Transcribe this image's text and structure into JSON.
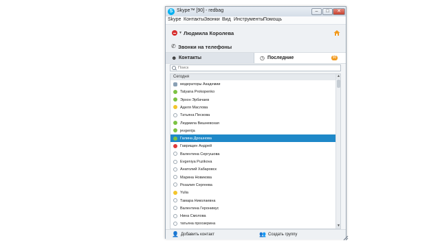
{
  "window": {
    "title": "Skype™ [90] - redbag",
    "icon_letter": "S",
    "controls": {
      "minimize": "–",
      "maximize": "□",
      "close": "✕"
    }
  },
  "menu": [
    "Skype",
    "Контакты",
    "Звонки",
    "Вид",
    "Инструменты",
    "Помощь"
  ],
  "profile": {
    "name": "Людмила Королева",
    "status": "busy",
    "home_icon": "home-icon"
  },
  "calls": {
    "label": "Звонки на телефоны"
  },
  "tabs": {
    "contacts": "Контакты",
    "recent": "Последние",
    "recent_badge": "90"
  },
  "search": {
    "placeholder": "Поиск"
  },
  "list": {
    "group": "Сегодня",
    "contacts": [
      {
        "name": "модераторы Академии",
        "status": "group"
      },
      {
        "name": "Tatyana Prokopenko",
        "status": "online"
      },
      {
        "name": "Эрхон Эрбачаев",
        "status": "online"
      },
      {
        "name": "Аделя Маслова",
        "status": "away"
      },
      {
        "name": "Татьяна Пескова",
        "status": "offline"
      },
      {
        "name": "Людмила Вишневская",
        "status": "online"
      },
      {
        "name": "jevgenija",
        "status": "online"
      },
      {
        "name": "Галина Дрошнова",
        "status": "online",
        "selected": true
      },
      {
        "name": "Гаврищин Андрей",
        "status": "busy"
      },
      {
        "name": "Валентина Сергушова",
        "status": "offline"
      },
      {
        "name": "Evgeniya Puzikova",
        "status": "offline"
      },
      {
        "name": "Анатолий Хабаровск",
        "status": "offline"
      },
      {
        "name": "Марина Новикова",
        "status": "offline"
      },
      {
        "name": "Розалия Сергеева",
        "status": "offline"
      },
      {
        "name": "Yulia",
        "status": "away"
      },
      {
        "name": "Тамара Николаевна",
        "status": "offline"
      },
      {
        "name": "Валентина Геронимус",
        "status": "offline"
      },
      {
        "name": "Нина Смолова",
        "status": "offline"
      },
      {
        "name": "татьяна проозерина",
        "status": "offline"
      }
    ]
  },
  "footer": {
    "add_contact": "Добавить контакт",
    "create_group": "Создать группу"
  },
  "colors": {
    "accent": "#1e88c8",
    "badge": "#f29a1d",
    "busy": "#e03a3a",
    "online": "#7dc243"
  }
}
